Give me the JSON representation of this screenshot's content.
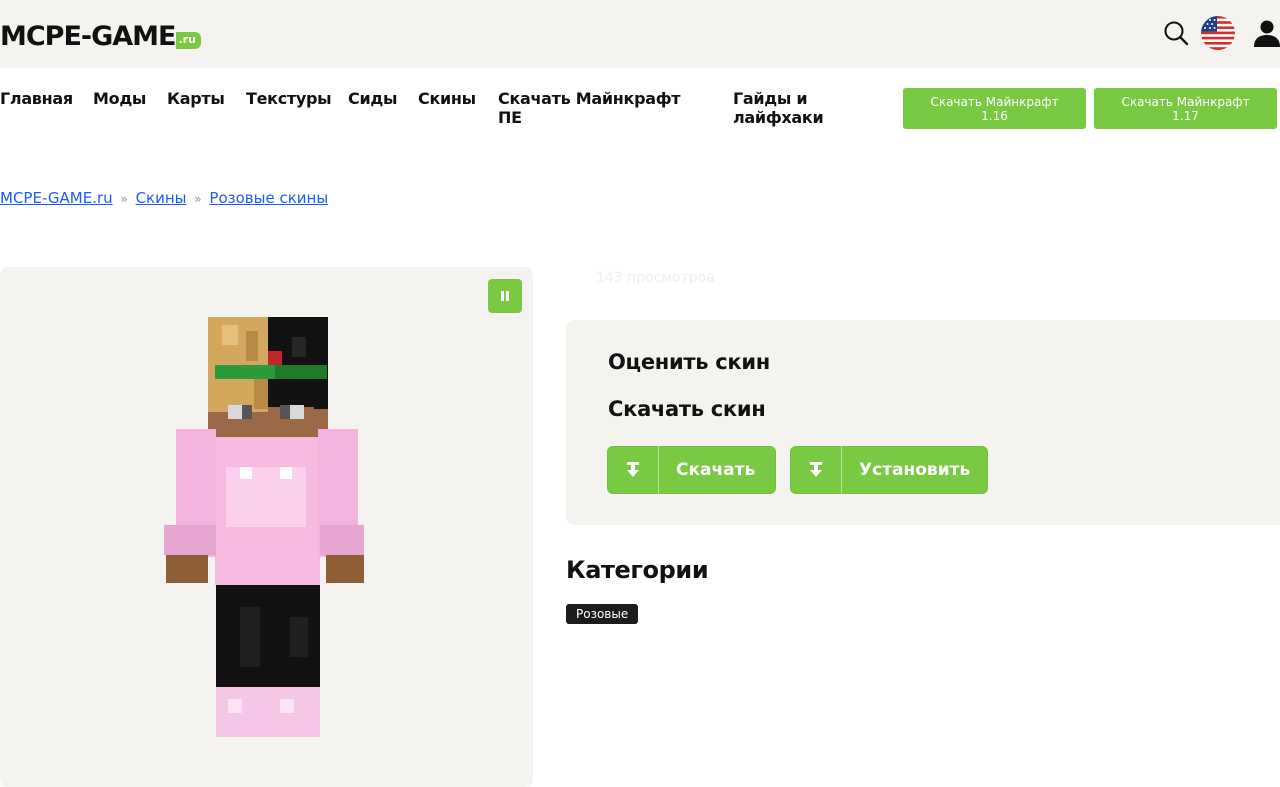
{
  "header": {
    "logo_main": "MCPE-GAME",
    "logo_ru": ".ru"
  },
  "nav": {
    "items": [
      {
        "label": "Главная"
      },
      {
        "label": "Моды"
      },
      {
        "label": "Карты"
      },
      {
        "label": "Текстуры"
      },
      {
        "label": "Сиды"
      },
      {
        "label": "Скины"
      },
      {
        "label": "Скачать Майнкрафт ПЕ"
      },
      {
        "label": "Гайды и лайфхаки"
      }
    ],
    "download_buttons": [
      {
        "line1": "Скачать Майнкрафт",
        "line2": "1.16"
      },
      {
        "line1": "Скачать Майнкрафт",
        "line2": "1.17"
      }
    ]
  },
  "breadcrumb": {
    "items": [
      {
        "label": "MCPE-GAME.ru"
      },
      {
        "label": "Скины"
      },
      {
        "label": "Розовые скины"
      }
    ],
    "separator": "»"
  },
  "skin": {
    "views": "143 просмотров"
  },
  "rate_card": {
    "rate_title": "Оценить скин",
    "download_title": "Скачать скин",
    "download_button": "Скачать",
    "install_button": "Установить"
  },
  "categories": {
    "title": "Категории",
    "tags": [
      {
        "label": "Розовые"
      }
    ]
  },
  "colors": {
    "accent": "#7ac943",
    "panel_bg": "#f5f3ef",
    "link": "#1a5cff"
  },
  "icons": [
    "search-icon",
    "us-flag-icon",
    "user-icon",
    "pause-icon",
    "download-icon",
    "install-icon"
  ]
}
